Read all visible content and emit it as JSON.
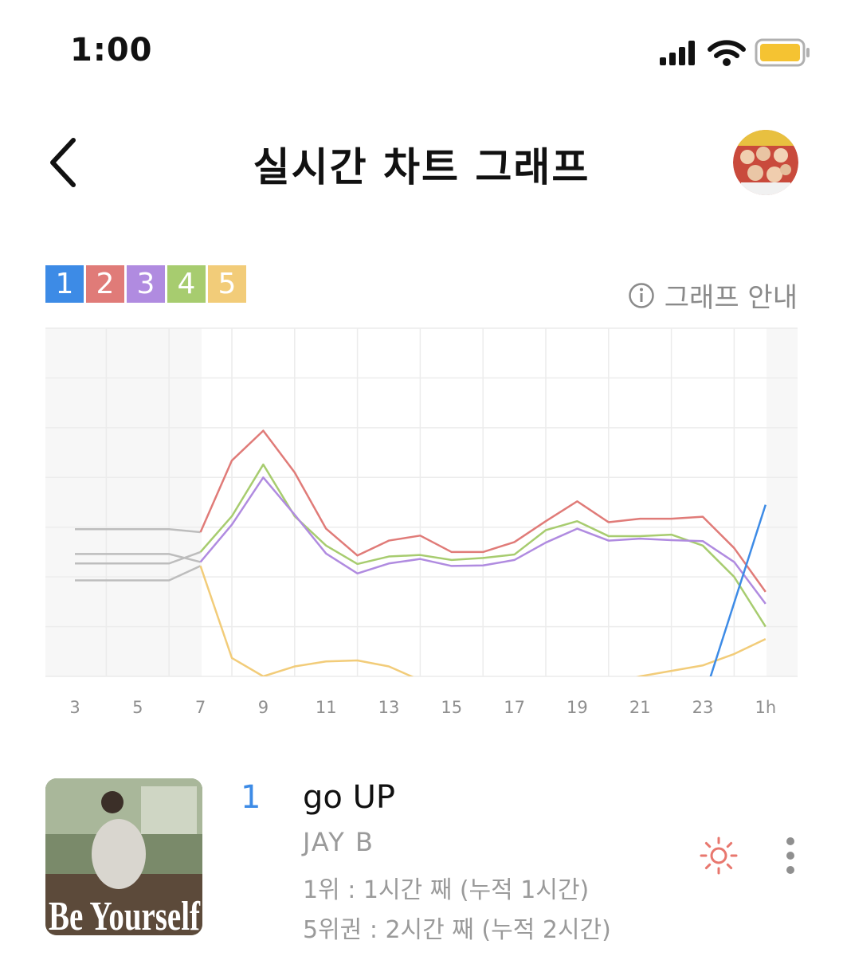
{
  "status_bar": {
    "time": "1:00",
    "signal_icon": "signal-bars-icon",
    "wifi_icon": "wifi-icon",
    "battery_icon": "battery-icon",
    "battery_color": "#f5c332"
  },
  "header": {
    "back_icon": "chevron-left-icon",
    "title": "실시간 차트 그래프",
    "avatar_icon": "group-photo-avatar"
  },
  "legend": {
    "ranks": [
      {
        "label": "1",
        "color": "#3d8be6"
      },
      {
        "label": "2",
        "color": "#e07b78"
      },
      {
        "label": "3",
        "color": "#b08be0"
      },
      {
        "label": "4",
        "color": "#a7cc6f"
      },
      {
        "label": "5",
        "color": "#f2cc79"
      }
    ],
    "guide_icon": "info-circle-icon",
    "guide_label": "그래프 안내"
  },
  "chart_data": {
    "type": "line",
    "x_ticks": [
      "3",
      "5",
      "7",
      "9",
      "11",
      "13",
      "15",
      "17",
      "19",
      "21",
      "23",
      "1h"
    ],
    "hours": [
      3,
      4,
      5,
      6,
      7,
      8,
      9,
      10,
      11,
      12,
      13,
      14,
      15,
      16,
      17,
      18,
      19,
      20,
      21,
      22,
      23,
      24,
      25
    ],
    "y_reversed": true,
    "y_range": [
      0,
      7
    ],
    "grid": true,
    "series": [
      {
        "name": "1",
        "color": "#3d8be6",
        "points": [
          [
            23.2,
            7.1
          ],
          [
            25,
            3.55
          ]
        ]
      },
      {
        "name": "2",
        "color": "#e07b78",
        "points": [
          [
            3,
            4.04
          ],
          [
            4,
            4.04
          ],
          [
            5,
            4.04
          ],
          [
            6,
            4.04
          ],
          [
            7,
            4.1
          ],
          [
            8,
            2.66
          ],
          [
            9,
            2.06
          ],
          [
            10,
            2.9
          ],
          [
            11,
            4.03
          ],
          [
            12,
            4.57
          ],
          [
            13,
            4.27
          ],
          [
            14,
            4.17
          ],
          [
            15,
            4.5
          ],
          [
            16,
            4.5
          ],
          [
            17,
            4.3
          ],
          [
            18,
            3.88
          ],
          [
            19,
            3.48
          ],
          [
            20,
            3.9
          ],
          [
            21,
            3.83
          ],
          [
            22,
            3.83
          ],
          [
            23,
            3.79
          ],
          [
            24,
            4.42
          ],
          [
            25,
            5.3
          ]
        ]
      },
      {
        "name": "3",
        "color": "#b08be0",
        "points": [
          [
            3,
            4.54
          ],
          [
            4,
            4.54
          ],
          [
            5,
            4.54
          ],
          [
            6,
            4.54
          ],
          [
            7,
            4.7
          ],
          [
            8,
            3.95
          ],
          [
            9,
            3.0
          ],
          [
            10,
            3.75
          ],
          [
            11,
            4.53
          ],
          [
            12,
            4.93
          ],
          [
            13,
            4.73
          ],
          [
            14,
            4.64
          ],
          [
            15,
            4.78
          ],
          [
            16,
            4.77
          ],
          [
            17,
            4.66
          ],
          [
            18,
            4.31
          ],
          [
            19,
            4.03
          ],
          [
            20,
            4.27
          ],
          [
            21,
            4.23
          ],
          [
            22,
            4.26
          ],
          [
            23,
            4.28
          ],
          [
            24,
            4.7
          ],
          [
            25,
            5.54
          ]
        ]
      },
      {
        "name": "4",
        "color": "#a7cc6f",
        "points": [
          [
            3,
            4.73
          ],
          [
            4,
            4.73
          ],
          [
            5,
            4.73
          ],
          [
            6,
            4.73
          ],
          [
            7,
            4.5
          ],
          [
            8,
            3.78
          ],
          [
            9,
            2.74
          ],
          [
            10,
            3.78
          ],
          [
            11,
            4.37
          ],
          [
            12,
            4.74
          ],
          [
            13,
            4.59
          ],
          [
            14,
            4.56
          ],
          [
            15,
            4.66
          ],
          [
            16,
            4.62
          ],
          [
            17,
            4.55
          ],
          [
            18,
            4.06
          ],
          [
            19,
            3.88
          ],
          [
            20,
            4.18
          ],
          [
            21,
            4.18
          ],
          [
            22,
            4.15
          ],
          [
            23,
            4.37
          ],
          [
            24,
            5.0
          ],
          [
            25,
            6.0
          ]
        ]
      },
      {
        "name": "5",
        "color": "#f2cc79",
        "points": [
          [
            3,
            5.07
          ],
          [
            4,
            5.07
          ],
          [
            5,
            5.07
          ],
          [
            6,
            5.07
          ],
          [
            7,
            4.78
          ],
          [
            8,
            6.63
          ],
          [
            9,
            7.0
          ],
          [
            10,
            6.8
          ],
          [
            11,
            6.7
          ],
          [
            12,
            6.68
          ],
          [
            13,
            6.8
          ],
          [
            13.9,
            7.05
          ],
          [
            20.7,
            7.05
          ],
          [
            21,
            7.0
          ],
          [
            22,
            6.89
          ],
          [
            23,
            6.78
          ],
          [
            24,
            6.55
          ],
          [
            25,
            6.25
          ]
        ]
      }
    ]
  },
  "song": {
    "rank": "1",
    "title": "go UP",
    "artist": "JAY B",
    "stat_first": "1위 : 1시간 째 (누적 1시간)",
    "stat_top5": "5위권 : 2시간 째 (누적 2시간)",
    "album_text": "Be Yourself",
    "sun_icon": "sun-icon",
    "more_icon": "more-vertical-icon"
  }
}
